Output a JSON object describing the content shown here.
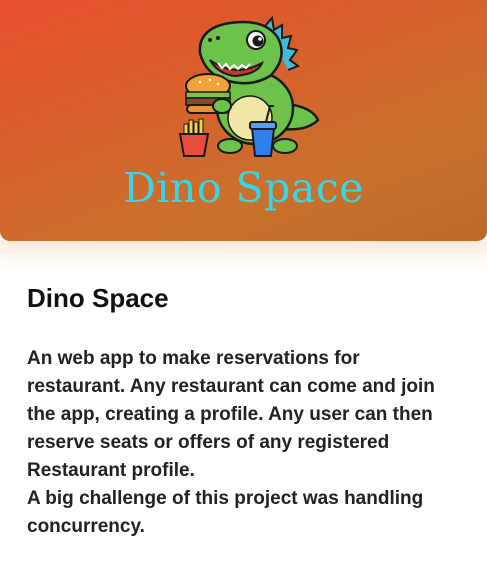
{
  "project": {
    "banner_title": "Dino Space",
    "title": "Dino Space",
    "description": [
      "An web app to make reservations for restaurant. Any restaurant can come and join the app, creating a profile. Any user can then reserve seats or offers of any registered Restaurant profile.",
      "A big challenge of this project was handling concurrency."
    ]
  },
  "theme": {
    "banner_gradient_start": "#e8502e",
    "banner_gradient_end": "#bb6a2a",
    "banner_title_color": "#35d7e6",
    "text_color": "#222222"
  },
  "logo": {
    "icon": "dinosaur-eating-burger-icon"
  }
}
